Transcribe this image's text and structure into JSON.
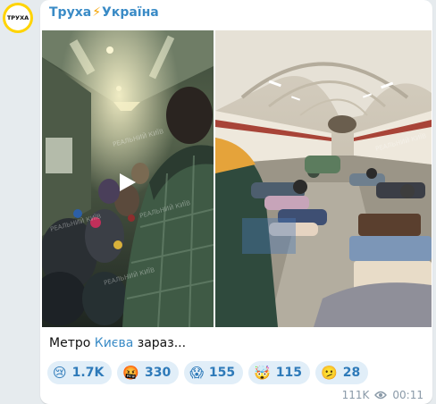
{
  "channel": {
    "avatar_text": "ТРУХА",
    "name_part1": "Труха",
    "bolt": "⚡",
    "name_part2": "Україна"
  },
  "media": {
    "left_image": "kyiv-metro-crowd-video",
    "right_image": "kyiv-metro-platform-shelter",
    "watermark": "РЕАЛЬНИЙ КИЇВ"
  },
  "caption": {
    "before": "Метро ",
    "link": "Києва",
    "after": " зараз..."
  },
  "reactions": [
    {
      "emoji": "😢",
      "count": "1.7K"
    },
    {
      "emoji": "🤬",
      "count": "330"
    },
    {
      "emoji": "😱",
      "count": "155"
    },
    {
      "emoji": "🤯",
      "count": "115"
    },
    {
      "emoji": "🫤",
      "count": "28"
    }
  ],
  "meta": {
    "views": "111K",
    "time": "00:11"
  },
  "colors": {
    "accent": "#3a8bc6",
    "bolt": "#f5a300",
    "avatar_ring": "#ffd400",
    "reaction_bg": "#e1eef8"
  }
}
